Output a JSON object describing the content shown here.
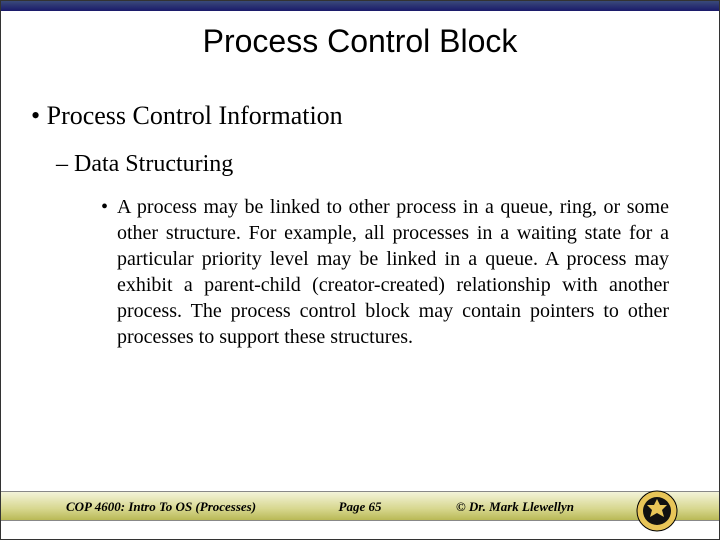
{
  "title": "Process Control Block",
  "bullet_l1_marker": "•",
  "bullet_l1_text": "Process Control Information",
  "bullet_l2_marker": "–",
  "bullet_l2_text": "Data Structuring",
  "bullet_l3_marker": "•",
  "bullet_l3_text": "A process may be linked to other process in a queue, ring, or some other structure. For example, all processes in a waiting state for a particular priority level may be linked in a queue. A process may exhibit a parent-child (creator-created) relationship with another process. The process control block may contain pointers to other processes to support these structures.",
  "footer": {
    "course": "COP 4600: Intro To OS  (Processes)",
    "page": "Page 65",
    "author": "© Dr. Mark Llewellyn"
  }
}
